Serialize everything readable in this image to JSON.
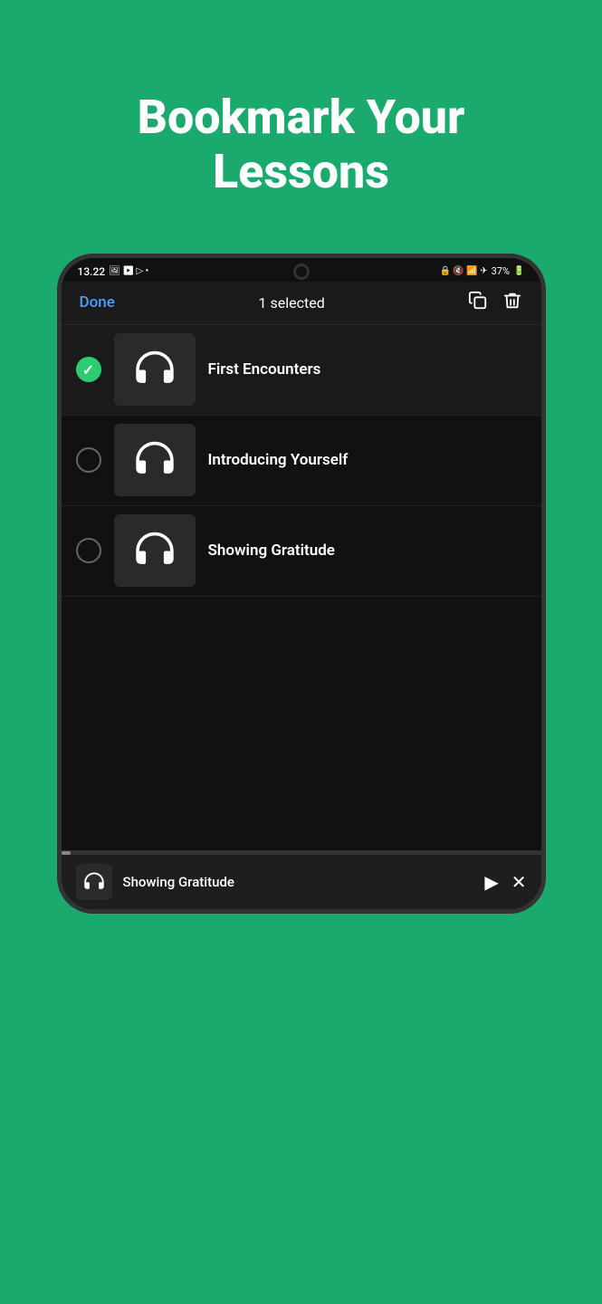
{
  "page": {
    "background_color": "#1aaa6e",
    "header": {
      "title": "Bookmark Your Lessons"
    }
  },
  "status_bar": {
    "time": "13.22",
    "battery": "37%"
  },
  "toolbar": {
    "done_label": "Done",
    "selected_count": "1 selected"
  },
  "lessons": [
    {
      "id": 1,
      "title": "First Encounters",
      "selected": true
    },
    {
      "id": 2,
      "title": "Introducing Yourself",
      "selected": false
    },
    {
      "id": 3,
      "title": "Showing Gratitude",
      "selected": false
    }
  ],
  "mini_player": {
    "title": "Showing Gratitude"
  },
  "icons": {
    "copy_icon": "⧉",
    "delete_icon": "🗑",
    "play_icon": "▶",
    "close_icon": "✕"
  }
}
